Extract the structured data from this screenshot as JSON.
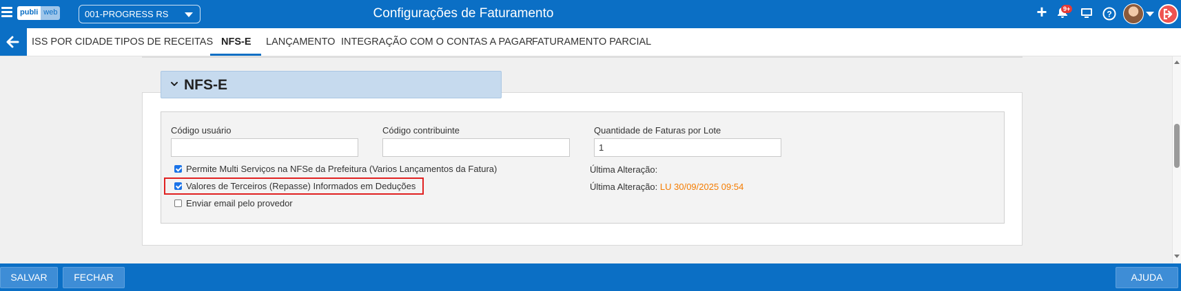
{
  "header": {
    "logo_part1": "publi",
    "logo_part2": "web",
    "company_select_value": "001-PROGRESS RS",
    "title": "Configurações de Faturamento",
    "notifications_badge": "9+"
  },
  "tabs": [
    {
      "label": "ISS POR CIDADE"
    },
    {
      "label": "TIPOS DE RECEITAS"
    },
    {
      "label": "NFS-E",
      "active": true
    },
    {
      "label": "LANÇAMENTO"
    },
    {
      "label": "INTEGRAÇÃO COM O CONTAS A PAGAR"
    },
    {
      "label": "FATURAMENTO PARCIAL"
    }
  ],
  "section": {
    "title": "NFS-E"
  },
  "fields": {
    "codigo_usuario": {
      "label": "Código usuário",
      "value": ""
    },
    "codigo_contribuinte": {
      "label": "Código contribuinte",
      "value": ""
    },
    "quantidade_faturas": {
      "label": "Quantidade de Faturas por Lote",
      "value": "1"
    }
  },
  "checkboxes": [
    {
      "label": "Permite Multi Serviços na NFSe da Prefeitura (Varios Lançamentos da Fatura)",
      "checked": true
    },
    {
      "label": "Valores de Terceiros (Repasse) Informados em Deduções",
      "checked": true
    },
    {
      "label": "Enviar email pelo provedor",
      "checked": false
    }
  ],
  "info": {
    "ultima_alteracao_1_label": "Última Alteração:",
    "ultima_alteracao_2_label": "Última Alteração:",
    "ultima_alteracao_2_value": "LU 30/09/2025 09:54"
  },
  "footer": {
    "save_label": "SALVAR",
    "close_label": "FECHAR",
    "help_label": "AJUDA"
  },
  "colors": {
    "primary": "#0b6fc5",
    "accent_orange": "#f57c00",
    "highlight_red": "#e02020"
  }
}
